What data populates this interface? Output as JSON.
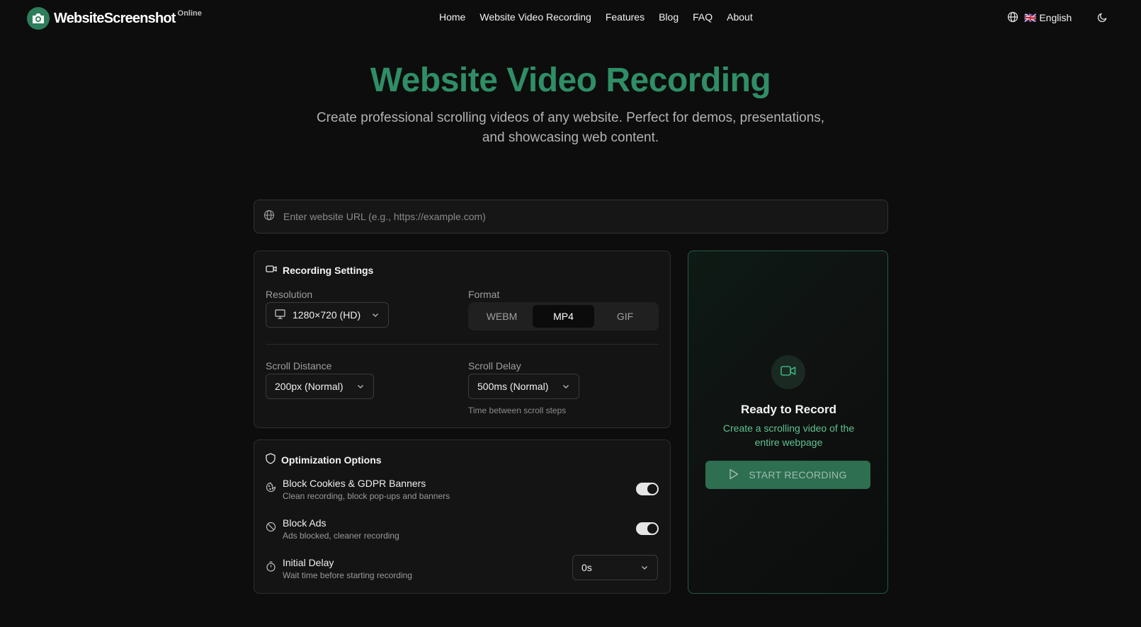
{
  "header": {
    "logo_text": "WebsiteScreenshot",
    "logo_sup": "Online",
    "nav": [
      "Home",
      "Website Video Recording",
      "Features",
      "Blog",
      "FAQ",
      "About"
    ],
    "language": "🇬🇧 English"
  },
  "hero": {
    "title": "Website Video Recording",
    "subtitle_line1": "Create professional scrolling videos of any website. Perfect for demos, presentations,",
    "subtitle_line2": "and showcasing web content."
  },
  "url_input": {
    "placeholder": "Enter website URL (e.g., https://example.com)",
    "value": ""
  },
  "recording_settings": {
    "title": "Recording Settings",
    "resolution_label": "Resolution",
    "resolution_value": "1280×720 (HD)",
    "format_label": "Format",
    "formats": [
      "WEBM",
      "MP4",
      "GIF"
    ],
    "selected_format": "MP4",
    "scroll_distance_label": "Scroll Distance",
    "scroll_distance_value": "200px (Normal)",
    "scroll_delay_label": "Scroll Delay",
    "scroll_delay_value": "500ms (Normal)",
    "scroll_delay_hint": "Time between scroll steps"
  },
  "optimization": {
    "title": "Optimization Options",
    "options": [
      {
        "title": "Block Cookies & GDPR Banners",
        "desc": "Clean recording, block pop-ups and banners",
        "enabled": true
      },
      {
        "title": "Block Ads",
        "desc": "Ads blocked, cleaner recording",
        "enabled": true
      }
    ],
    "initial_delay": {
      "title": "Initial Delay",
      "desc": "Wait time before starting recording",
      "value": "0s"
    }
  },
  "preview": {
    "title": "Ready to Record",
    "subtitle_line1": "Create a scrolling video of the",
    "subtitle_line2": "entire webpage",
    "button": "START RECORDING"
  },
  "colors": {
    "accent": "#2f8e66",
    "accent_text": "#5fc191",
    "background": "#0d0d0d",
    "button_bg": "#2e6e51"
  }
}
